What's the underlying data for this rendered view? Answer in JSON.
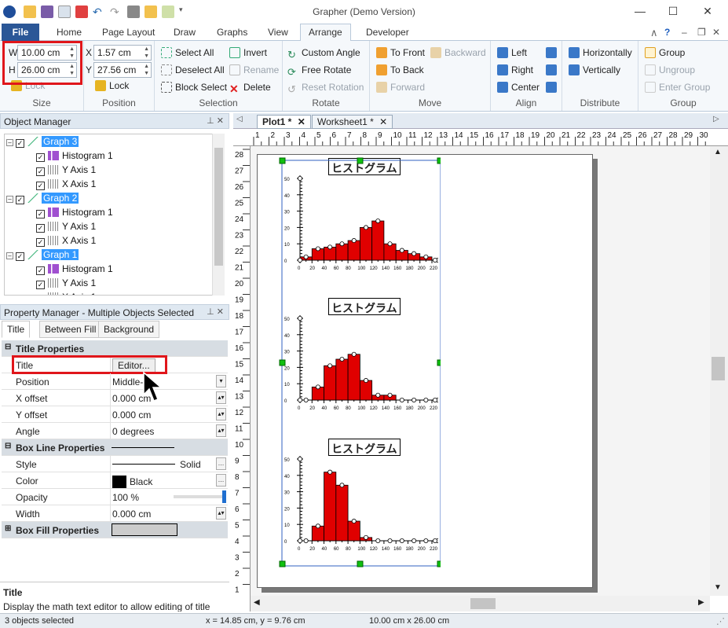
{
  "app": {
    "title": "Grapher (Demo Version)"
  },
  "ribbon_tabs": [
    "File",
    "Home",
    "Page Layout",
    "Draw",
    "Graphs",
    "View",
    "Arrange",
    "Developer"
  ],
  "active_tab": "Arrange",
  "size": {
    "w_label": "W",
    "w_value": "10.00 cm",
    "h_label": "H",
    "h_value": "26.00 cm",
    "lock": "Lock",
    "group": "Size"
  },
  "position": {
    "x_label": "X",
    "x_value": "1.57 cm",
    "y_label": "Y",
    "y_value": "27.56 cm",
    "lock": "Lock",
    "group": "Position"
  },
  "selection": {
    "select_all": "Select All",
    "invert": "Invert",
    "deselect_all": "Deselect All",
    "rename": "Rename",
    "block_select": "Block Select",
    "delete": "Delete",
    "group": "Selection"
  },
  "rotate": {
    "custom_angle": "Custom Angle",
    "free_rotate": "Free Rotate",
    "reset_rotation": "Reset Rotation",
    "group": "Rotate"
  },
  "move": {
    "to_front": "To Front",
    "backward": "Backward",
    "to_back": "To Back",
    "forward": "Forward",
    "group": "Move"
  },
  "align": {
    "left": "Left",
    "right": "Right",
    "center": "Center",
    "group": "Align"
  },
  "distribute": {
    "horizontally": "Horizontally",
    "vertically": "Vertically",
    "group": "Distribute"
  },
  "grouping": {
    "group_item": "Group",
    "ungroup": "Ungroup",
    "enter_group": "Enter Group",
    "group": "Group"
  },
  "object_manager": {
    "title": "Object Manager",
    "items": [
      {
        "label": "Graph 3",
        "level": 0,
        "selected": true
      },
      {
        "label": "Histogram 1",
        "level": 1
      },
      {
        "label": "Y Axis 1",
        "level": 1
      },
      {
        "label": "X Axis 1",
        "level": 1
      },
      {
        "label": "Graph 2",
        "level": 0,
        "selected": true
      },
      {
        "label": "Histogram 1",
        "level": 1
      },
      {
        "label": "Y Axis 1",
        "level": 1
      },
      {
        "label": "X Axis 1",
        "level": 1
      },
      {
        "label": "Graph 1",
        "level": 0,
        "selected": true
      },
      {
        "label": "Histogram 1",
        "level": 1
      },
      {
        "label": "Y Axis 1",
        "level": 1
      },
      {
        "label": "X Axis 1",
        "level": 1
      }
    ]
  },
  "property_manager": {
    "title": "Property Manager - Multiple Objects Selected",
    "tabs": [
      "Title",
      "Between Fill",
      "Background"
    ],
    "sections": {
      "title_props": "Title Properties",
      "box_line": "Box Line Properties",
      "box_fill": "Box Fill Properties"
    },
    "rows": {
      "title": {
        "k": "Title",
        "v": "Editor..."
      },
      "position": {
        "k": "Position",
        "v": "Middle-"
      },
      "x_offset": {
        "k": "X offset",
        "v": "0.000 cm"
      },
      "y_offset": {
        "k": "Y offset",
        "v": "0.000 cm"
      },
      "angle": {
        "k": "Angle",
        "v": "0 degrees"
      },
      "style": {
        "k": "Style",
        "v": "Solid"
      },
      "color": {
        "k": "Color",
        "v": "Black"
      },
      "opacity": {
        "k": "Opacity",
        "v": "100 %"
      },
      "width": {
        "k": "Width",
        "v": "0.000 cm"
      }
    },
    "help_title": "Title",
    "help_text": "Display the math text editor to allow editing of title"
  },
  "doc_tabs": [
    "Plot1 *",
    "Worksheet1 *"
  ],
  "graphs": [
    {
      "title": "ヒストグラム",
      "values": [
        2,
        7,
        8,
        10,
        12,
        20,
        24,
        10,
        6,
        4,
        2,
        0
      ]
    },
    {
      "title": "ヒストグラム",
      "values": [
        0,
        8,
        21,
        25,
        28,
        12,
        3,
        3,
        0,
        0,
        0,
        0
      ]
    },
    {
      "title": "ヒストグラム",
      "values": [
        0,
        9,
        42,
        34,
        12,
        2,
        0,
        0,
        0,
        0,
        0,
        0
      ]
    }
  ],
  "axis": {
    "x_ticks": [
      "0",
      "20",
      "40",
      "60",
      "80",
      "100",
      "120",
      "140",
      "160",
      "180",
      "200",
      "220"
    ],
    "y_ticks": [
      "0",
      "10",
      "20",
      "30",
      "40",
      "50"
    ]
  },
  "ruler": {
    "h": [
      "1",
      "2",
      "3",
      "4",
      "5",
      "6",
      "7",
      "8",
      "9",
      "10",
      "11",
      "12",
      "13",
      "14",
      "15",
      "16",
      "17",
      "18",
      "19",
      "20",
      "21",
      "22",
      "23",
      "24",
      "25",
      "26",
      "27",
      "28",
      "29",
      "30"
    ],
    "v": [
      "28",
      "27",
      "26",
      "25",
      "24",
      "23",
      "22",
      "21",
      "20",
      "19",
      "18",
      "17",
      "16",
      "15",
      "14",
      "13",
      "12",
      "11",
      "10",
      "9",
      "8",
      "7",
      "6",
      "5",
      "4",
      "3",
      "2",
      "1"
    ]
  },
  "status": {
    "left": "3 objects selected",
    "coords": "x = 14.85 cm, y = 9.76 cm",
    "size": "10.00 cm x 26.00 cm"
  },
  "colors": {
    "accent": "#2b5797",
    "bar": "#e00000",
    "highlight": "#e0161b"
  }
}
